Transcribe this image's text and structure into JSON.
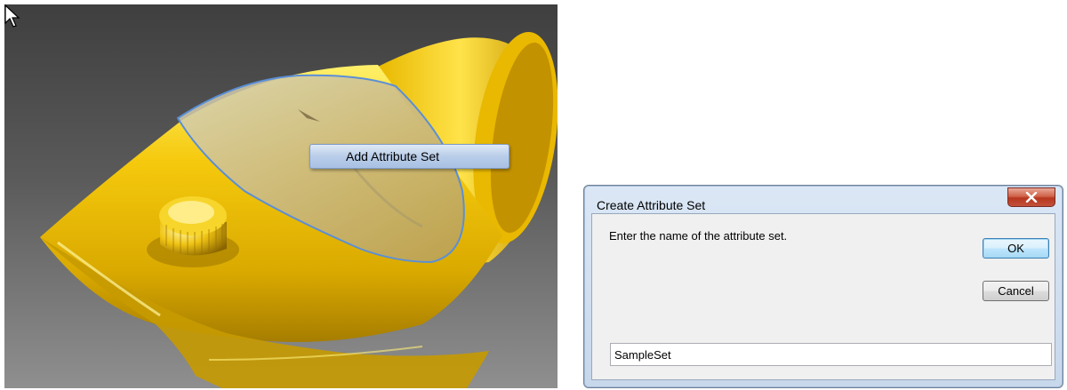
{
  "viewport": {
    "model_color": "#f5c90d",
    "selection_color": "#5b8fd6",
    "context_menu": {
      "item_label": "Add Attribute Set"
    }
  },
  "dialog": {
    "title": "Create Attribute Set",
    "close_icon": "x-icon",
    "prompt": "Enter the name of the attribute set.",
    "ok_label": "OK",
    "cancel_label": "Cancel",
    "name_value": "SampleSet"
  }
}
